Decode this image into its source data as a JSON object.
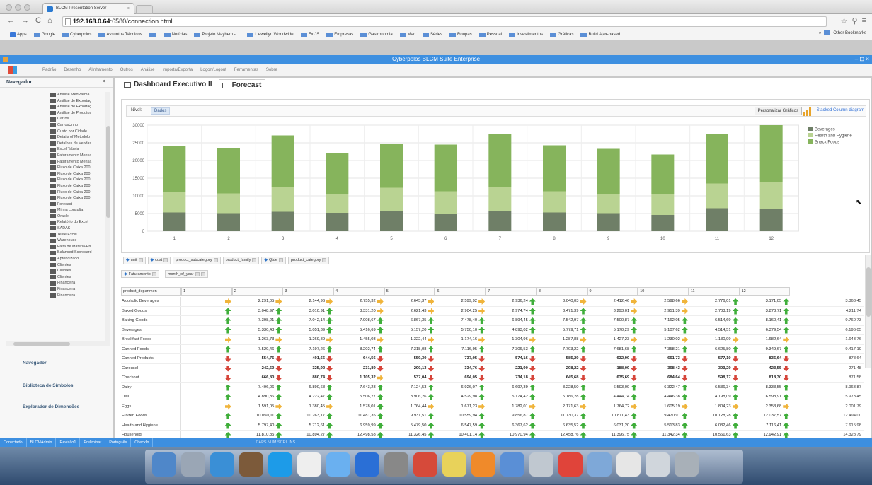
{
  "browser": {
    "tab_title": "BLCM Presentation Server",
    "tab_close": "×",
    "url_host": "192.168.0.64",
    "url_path": ":6580/connection.html",
    "nav": {
      "back": "←",
      "forward": "→",
      "reload": "C",
      "home": "⌂"
    },
    "right_icons": {
      "star": "☆",
      "wrench": "⚲",
      "menu": "≡"
    },
    "bookmarks": [
      "Apps",
      "Google",
      "Cyberpolos",
      "Assuntos Técnicos",
      "",
      "Notícias",
      "Projeto Mayhem - ...",
      "Llewellyn Worldwide",
      "ExtJS",
      "Empresas",
      "Gastronomia",
      "Mac",
      "Séries",
      "Roupas",
      "Pessoal",
      "Investimentos",
      "Gráficas",
      "Build Ajax-based ..."
    ],
    "other_bookmarks": "Other Bookmarks",
    "other_bookmarks_prefix": "»"
  },
  "app": {
    "title": "Cyberpolos BLCM Suite Enterprise",
    "window_controls": "– ⊡ ×",
    "menu": [
      "Padrão",
      "Desenho",
      "Alinhamento",
      "Outros",
      "Análise",
      "Importa/Exporta",
      "Logon/Logout",
      "Ferramentas",
      "Sobre"
    ]
  },
  "sidebar": {
    "title": "Navegador",
    "collapse": "<",
    "tree": [
      "Análise MedParma",
      "Análise de Exportaç",
      "Análise de Exportaç",
      "Análise de Produtos",
      "Carros",
      "CarrosUnno",
      "Custo por Cidade",
      "Details of Metodolo",
      "Detalhes de Vendas",
      "Excel Tabela",
      "Faturamento Mensa",
      "Faturamento Mensa",
      "Fluxo de Caixa 200",
      "Fluxo de Caixa 200",
      "Fluxo de Caixa 200",
      "Fluxo de Caixa 200",
      "Fluxo de Caixa 200",
      "Fluxo de Caixa 200",
      "Forecast",
      "Minha consulta",
      "Oracle",
      "Relatório do Excel",
      "SADAS",
      "Teste Excel",
      "Warehouse",
      "Falta de Matéria-Pri",
      "Balanced Scorecard",
      "Aprendizado",
      "Clientes",
      "Clientes",
      "Clientes",
      "Financeira",
      "Financeira",
      "Financeira"
    ],
    "links": [
      "Navegador",
      "Biblioteca de Símbolos",
      "Explorador de Dimensões"
    ]
  },
  "content": {
    "tabs": [
      "Dashboard Executivo II",
      "Forecast"
    ],
    "toolbar": {
      "level_label": "Nível:",
      "level_value": "Dados",
      "personalize": "Personalizar Gráficos",
      "chart_type": "Stacked Column diagram"
    },
    "splitter": "......",
    "column_dims": [
      "unit",
      "cost",
      "product_subcategory",
      "product_family",
      "Qtde",
      "product_category"
    ],
    "row_dims": [
      "Faturamento",
      "month_of_year"
    ],
    "row_dim_header": "product_departmen",
    "pivot": {
      "columns": [
        "1",
        "2",
        "3",
        "4",
        "5",
        "6",
        "7",
        "8",
        "9",
        "10",
        "11",
        "12"
      ],
      "rows": [
        {
          "label": "Alcoholic Beverages",
          "cells": [
            [
              "right",
              ""
            ],
            [
              "right",
              "2.291,05"
            ],
            [
              "right",
              "2.144,96"
            ],
            [
              "right",
              "2.755,32"
            ],
            [
              "right",
              "2.645,37"
            ],
            [
              "right",
              "2.599,92"
            ],
            [
              "up",
              "2.936,24"
            ],
            [
              "right",
              "3.040,03"
            ],
            [
              "right",
              "2.412,46"
            ],
            [
              "right",
              "2.598,66"
            ],
            [
              "up",
              "2.776,01"
            ],
            [
              "up",
              "3.171,05"
            ]
          ],
          "total": "3.363,45"
        },
        {
          "label": "Baked Goods",
          "cells": [
            [
              "up",
              ""
            ],
            [
              "up",
              "3.048,97"
            ],
            [
              "up",
              "3.010,91"
            ],
            [
              "right",
              "3.331,20"
            ],
            [
              "right",
              "2.621,43"
            ],
            [
              "right",
              "2.904,25"
            ],
            [
              "up",
              "2.974,74"
            ],
            [
              "up",
              "3.471,39"
            ],
            [
              "right",
              "3.293,01"
            ],
            [
              "right",
              "2.951,39"
            ],
            [
              "up",
              "2.703,19"
            ],
            [
              "up",
              "3.873,71"
            ]
          ],
          "total": "4.211,74"
        },
        {
          "label": "Baking Goods",
          "cells": [
            [
              "up",
              ""
            ],
            [
              "up",
              "7.398,21"
            ],
            [
              "up",
              "7.042,14"
            ],
            [
              "up",
              "7.908,67"
            ],
            [
              "up",
              "6.867,35"
            ],
            [
              "up",
              "7.478,40"
            ],
            [
              "up",
              "6.894,45"
            ],
            [
              "up",
              "7.542,97"
            ],
            [
              "up",
              "7.500,87"
            ],
            [
              "up",
              "7.162,05"
            ],
            [
              "up",
              "6.514,69"
            ],
            [
              "up",
              "8.160,41"
            ]
          ],
          "total": "9.760,73"
        },
        {
          "label": "Beverages",
          "cells": [
            [
              "up",
              ""
            ],
            [
              "up",
              "5.330,43"
            ],
            [
              "up",
              "5.051,39"
            ],
            [
              "up",
              "5.416,69"
            ],
            [
              "up",
              "5.157,20"
            ],
            [
              "up",
              "5.750,10"
            ],
            [
              "up",
              "4.893,02"
            ],
            [
              "up",
              "5.779,71"
            ],
            [
              "up",
              "5.170,29"
            ],
            [
              "up",
              "5.107,62"
            ],
            [
              "up",
              "4.514,51"
            ],
            [
              "up",
              "6.379,54"
            ]
          ],
          "total": "6.196,05"
        },
        {
          "label": "Breakfast Foods",
          "cells": [
            [
              "right",
              ""
            ],
            [
              "right",
              "1.263,73"
            ],
            [
              "right",
              "1.269,89"
            ],
            [
              "right",
              "1.455,03"
            ],
            [
              "right",
              "1.322,44"
            ],
            [
              "right",
              "1.174,16"
            ],
            [
              "right",
              "1.304,96"
            ],
            [
              "right",
              "1.287,88"
            ],
            [
              "right",
              "1.427,23"
            ],
            [
              "right",
              "1.230,02"
            ],
            [
              "right",
              "1.130,99"
            ],
            [
              "right",
              "1.682,64"
            ]
          ],
          "total": "1.643,76"
        },
        {
          "label": "Canned Foods",
          "cells": [
            [
              "up",
              ""
            ],
            [
              "up",
              "7.529,46"
            ],
            [
              "up",
              "7.197,26"
            ],
            [
              "up",
              "8.202,74"
            ],
            [
              "up",
              "7.318,08"
            ],
            [
              "up",
              "7.116,95"
            ],
            [
              "up",
              "7.306,53"
            ],
            [
              "up",
              "7.703,22"
            ],
            [
              "up",
              "7.681,68"
            ],
            [
              "up",
              "7.358,21"
            ],
            [
              "up",
              "6.625,80"
            ],
            [
              "up",
              "9.349,67"
            ]
          ],
          "total": "9.417,19"
        },
        {
          "label": "Canned Products",
          "bold": true,
          "cells": [
            [
              "down",
              ""
            ],
            [
              "down",
              "554,75"
            ],
            [
              "down",
              "491,66"
            ],
            [
              "down",
              "644,56"
            ],
            [
              "down",
              "559,30"
            ],
            [
              "down",
              "737,05"
            ],
            [
              "down",
              "574,16"
            ],
            [
              "down",
              "585,29"
            ],
            [
              "down",
              "632,99"
            ],
            [
              "down",
              "661,73"
            ],
            [
              "down",
              "577,10"
            ],
            [
              "down",
              "836,64"
            ]
          ],
          "total": "878,64"
        },
        {
          "label": "Carousel",
          "bold": true,
          "cells": [
            [
              "down",
              ""
            ],
            [
              "down",
              "242,60"
            ],
            [
              "down",
              "325,92"
            ],
            [
              "down",
              "231,89"
            ],
            [
              "down",
              "290,13"
            ],
            [
              "down",
              "334,76"
            ],
            [
              "down",
              "221,90"
            ],
            [
              "down",
              "298,22"
            ],
            [
              "down",
              "188,09"
            ],
            [
              "down",
              "368,43"
            ],
            [
              "down",
              "303,29"
            ],
            [
              "down",
              "423,55"
            ]
          ],
          "total": "271,48"
        },
        {
          "label": "Checkout",
          "bold": true,
          "cells": [
            [
              "down",
              ""
            ],
            [
              "down",
              "666,80"
            ],
            [
              "down",
              "880,74"
            ],
            [
              "right",
              "1.105,32"
            ],
            [
              "down",
              "537,04"
            ],
            [
              "down",
              "694,05"
            ],
            [
              "down",
              "734,18"
            ],
            [
              "down",
              "645,68"
            ],
            [
              "down",
              "635,69"
            ],
            [
              "down",
              "684,64"
            ],
            [
              "down",
              "598,17"
            ],
            [
              "down",
              "818,30"
            ]
          ],
          "total": "871,58"
        },
        {
          "label": "Dairy",
          "cells": [
            [
              "up",
              ""
            ],
            [
              "up",
              "7.496,06"
            ],
            [
              "up",
              "6.890,68"
            ],
            [
              "up",
              "7.643,23"
            ],
            [
              "up",
              "7.124,53"
            ],
            [
              "up",
              "6.926,07"
            ],
            [
              "up",
              "6.697,39"
            ],
            [
              "up",
              "8.228,50"
            ],
            [
              "up",
              "6.593,09"
            ],
            [
              "up",
              "6.322,47"
            ],
            [
              "up",
              "6.536,34"
            ],
            [
              "up",
              "8.333,55"
            ]
          ],
          "total": "8.963,87"
        },
        {
          "label": "Deli",
          "cells": [
            [
              "up",
              ""
            ],
            [
              "up",
              "4.890,36"
            ],
            [
              "up",
              "4.222,47"
            ],
            [
              "up",
              "5.506,27"
            ],
            [
              "up",
              "3.906,26"
            ],
            [
              "up",
              "4.529,98"
            ],
            [
              "up",
              "5.174,42"
            ],
            [
              "up",
              "5.186,28"
            ],
            [
              "up",
              "4.444,74"
            ],
            [
              "up",
              "4.446,38"
            ],
            [
              "up",
              "4.198,09"
            ],
            [
              "up",
              "6.598,91"
            ]
          ],
          "total": "5.973,45"
        },
        {
          "label": "Eggs",
          "cells": [
            [
              "right",
              ""
            ],
            [
              "right",
              "1.591,05"
            ],
            [
              "right",
              "1.380,45"
            ],
            [
              "up",
              "1.578,01"
            ],
            [
              "right",
              "1.764,44"
            ],
            [
              "right",
              "1.671,23"
            ],
            [
              "right",
              "1.782,01"
            ],
            [
              "right",
              "2.171,63"
            ],
            [
              "right",
              "1.764,72"
            ],
            [
              "right",
              "1.605,19"
            ],
            [
              "right",
              "1.804,23"
            ],
            [
              "right",
              "2.353,68"
            ]
          ],
          "total": "2.001,79"
        },
        {
          "label": "Frozen Foods",
          "cells": [
            [
              "up",
              ""
            ],
            [
              "up",
              "10.050,11"
            ],
            [
              "up",
              "10.263,17"
            ],
            [
              "up",
              "11.481,35"
            ],
            [
              "up",
              "9.931,51"
            ],
            [
              "up",
              "10.559,94"
            ],
            [
              "up",
              "9.856,87"
            ],
            [
              "up",
              "11.730,37"
            ],
            [
              "up",
              "10.811,43"
            ],
            [
              "up",
              "9.470,91"
            ],
            [
              "up",
              "10.128,28"
            ],
            [
              "up",
              "12.037,57"
            ]
          ],
          "total": "12.494,00"
        },
        {
          "label": "Health and Hygiene",
          "cells": [
            [
              "up",
              ""
            ],
            [
              "up",
              "5.797,40"
            ],
            [
              "up",
              "5.712,61"
            ],
            [
              "up",
              "6.959,99"
            ],
            [
              "up",
              "5.479,50"
            ],
            [
              "up",
              "6.547,59"
            ],
            [
              "up",
              "6.367,62"
            ],
            [
              "up",
              "6.635,52"
            ],
            [
              "up",
              "6.031,20"
            ],
            [
              "up",
              "5.513,83"
            ],
            [
              "up",
              "6.032,46"
            ],
            [
              "up",
              "7.116,41"
            ]
          ],
          "total": "7.615,98"
        },
        {
          "label": "Household",
          "cells": [
            [
              "up",
              ""
            ],
            [
              "up",
              "11.810,85"
            ],
            [
              "up",
              "10.894,27"
            ],
            [
              "up",
              "12.498,58"
            ],
            [
              "up",
              "11.326,45"
            ],
            [
              "up",
              "10.401,14"
            ],
            [
              "up",
              "10.970,94"
            ],
            [
              "up",
              "12.458,76"
            ],
            [
              "up",
              "11.396,75"
            ],
            [
              "up",
              "11.342,34"
            ],
            [
              "up",
              "10.561,63"
            ],
            [
              "up",
              "12.942,91"
            ]
          ],
          "total": "14.328,79"
        }
      ]
    }
  },
  "chart_data": {
    "type": "bar",
    "stacked": true,
    "categories": [
      "1",
      "2",
      "3",
      "4",
      "5",
      "6",
      "7",
      "8",
      "9",
      "10",
      "11",
      "12"
    ],
    "series": [
      {
        "name": "Beverages",
        "color": "#6f7f67",
        "values": [
          5300,
          5100,
          5500,
          5200,
          5800,
          5000,
          5800,
          5300,
          5100,
          4600,
          6500,
          6300
        ]
      },
      {
        "name": "Health and Hygiene",
        "color": "#b9d392",
        "values": [
          5800,
          5600,
          6900,
          5400,
          6500,
          6300,
          6700,
          6000,
          5500,
          6000,
          7000,
          7500
        ]
      },
      {
        "name": "Snack Foods",
        "color": "#86b45c",
        "values": [
          13000,
          12700,
          14700,
          11400,
          12300,
          13200,
          14900,
          13000,
          12700,
          11100,
          14000,
          16200
        ]
      }
    ],
    "ylim": [
      0,
      30000
    ],
    "yticks": [
      "30000",
      "25000",
      "20000",
      "15000",
      "10000",
      "5000",
      "0"
    ],
    "legend": "top-right",
    "grid": true
  },
  "status": {
    "items": [
      "Conectado",
      "BLCMAdmin",
      "Revisão1",
      "Preliminar",
      "Português",
      "CheckIn"
    ],
    "extras": "CAPS  NUM  SCRL  INS"
  },
  "colors": {
    "accent": "#3d8fe0",
    "up": "#3fae3a",
    "down": "#d6453a",
    "flat": "#f0b43a"
  }
}
